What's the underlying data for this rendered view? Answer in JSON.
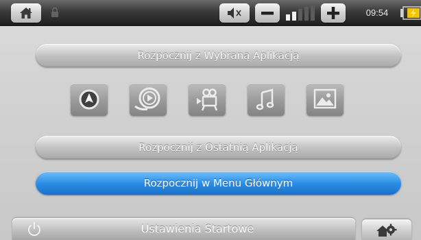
{
  "statusbar": {
    "time": "09:54",
    "volume_level": 0.4,
    "icons": {
      "home": "home-icon",
      "lock": "lock-icon",
      "mute": "speaker-icon",
      "minus": "minus-icon",
      "plus": "plus-icon",
      "battery": "battery-icon"
    }
  },
  "menu": {
    "selected_app_label": "Rozpocznij z Wybraną Aplikacją",
    "last_app_label": "Rozpocznij z Ostatnią Aplikacją",
    "main_menu_label": "Rozpocznij w Menu Głównym"
  },
  "apps": [
    {
      "icon": "navigation-icon"
    },
    {
      "icon": "video-player-icon"
    },
    {
      "icon": "camera-icon"
    },
    {
      "icon": "music-icon"
    },
    {
      "icon": "photo-icon"
    }
  ],
  "footer": {
    "settings_label": "Ustawienia Startowe",
    "icons": {
      "power": "power-icon",
      "gear": "gear-icon"
    }
  },
  "colors": {
    "accent": "#2d8fe6",
    "bar_dark": "#1e1e1e",
    "background": "#d2d2d2"
  }
}
